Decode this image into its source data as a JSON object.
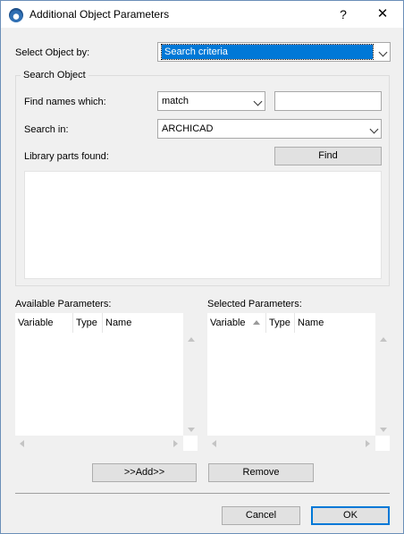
{
  "window": {
    "title": "Additional Object Parameters",
    "help_label": "?",
    "close_label": "✕"
  },
  "select_by": {
    "label": "Select Object by:",
    "value": "Search criteria"
  },
  "search_object": {
    "legend": "Search Object",
    "find_names_label": "Find names which:",
    "match_value": "match",
    "name_text_value": "",
    "search_in_label": "Search in:",
    "search_in_value": "ARCHICAD",
    "parts_found_label": "Library parts found:",
    "find_button": "Find",
    "results": []
  },
  "available_parameters": {
    "label": "Available Parameters:",
    "columns": [
      "Variable",
      "Type",
      "Name"
    ],
    "rows": []
  },
  "selected_parameters": {
    "label": "Selected Parameters:",
    "columns": [
      "Variable",
      "Type",
      "Name"
    ],
    "rows": []
  },
  "actions": {
    "add_button": ">>Add>>",
    "remove_button": "Remove"
  },
  "footer": {
    "cancel_button": "Cancel",
    "ok_button": "OK"
  },
  "colors": {
    "accent": "#0078d7",
    "window_bg": "#f0f0f0"
  }
}
